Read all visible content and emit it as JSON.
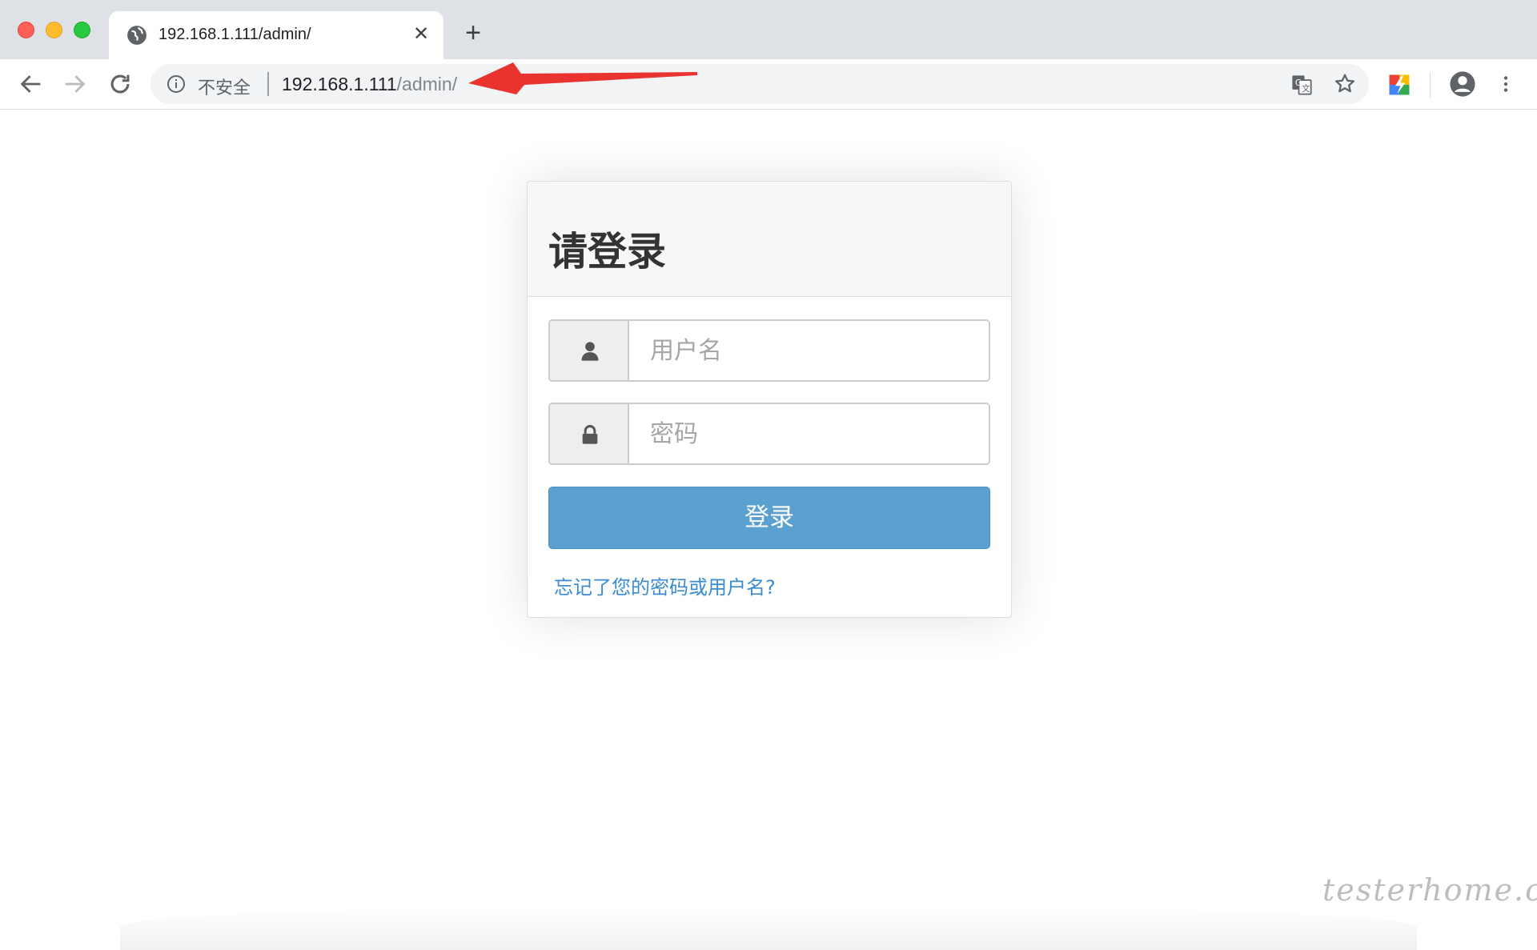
{
  "browser": {
    "tab": {
      "title": "192.168.1.111/admin/",
      "close_symbol": "✕"
    },
    "new_tab_symbol": "+",
    "omnibox": {
      "security_label": "不安全",
      "url_host": "192.168.1.111",
      "url_path": "/admin/"
    },
    "icons": [
      "globe-icon",
      "back-icon",
      "forward-icon",
      "reload-icon",
      "info-icon",
      "translate-icon",
      "bookmark-star-icon",
      "extension-icon",
      "profile-icon",
      "menu-icon"
    ]
  },
  "login": {
    "title": "请登录",
    "username_placeholder": "用户名",
    "password_placeholder": "密码",
    "submit_label": "登录",
    "forgot_link": "忘记了您的密码或用户名?"
  },
  "watermark": "testerhome.com",
  "colors": {
    "button_primary": "#5aa0d0",
    "link": "#3a8bd0",
    "annotation_arrow": "#e8332f"
  }
}
